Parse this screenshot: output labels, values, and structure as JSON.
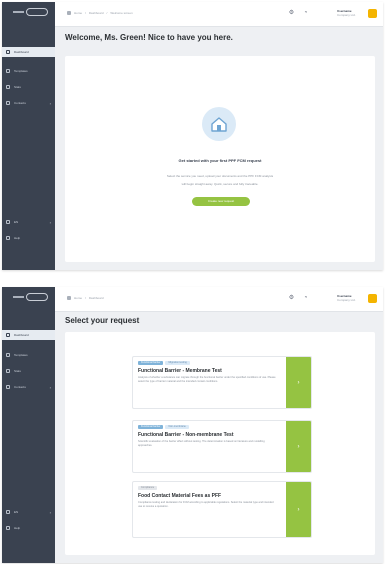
{
  "screen1": {
    "sidebar": {
      "items": [
        {
          "label": "Dashboard",
          "icon": "grid-icon"
        },
        {
          "label": "Templates",
          "icon": "document-icon"
        },
        {
          "label": "Stats",
          "icon": "chart-icon"
        },
        {
          "label": "Contacts",
          "icon": "people-icon"
        }
      ],
      "bottom_items": [
        {
          "label": "EN",
          "icon": "globe-icon"
        },
        {
          "label": "Help",
          "icon": "help-icon"
        }
      ]
    },
    "topbar": {
      "breadcrumb": [
        "Home",
        "Dashboard",
        "Welcome screen"
      ],
      "user_name": "Username",
      "user_company": "Company Ltd."
    },
    "page_title": "Welcome, Ms. Green! Nice to have you here.",
    "empty_state": {
      "title": "Get started with your first PPF FCM request",
      "text_line1": "Select the service you need, upload your documents and the PPF FCM analysis",
      "text_line2": "will begin straight away. Quick, secure and fully traceable.",
      "button": "Create new request"
    }
  },
  "screen2": {
    "page_title": "Select your request",
    "cards": [
      {
        "badges": [
          "Functional barrier",
          "Migration testing"
        ],
        "title": "Functional Barrier - Membrane Test",
        "desc": "Analysis of whether a substance can migrate through the functional barrier under the specified conditions of use. Please select the type of barrier material and the intended contact conditions."
      },
      {
        "badges": [
          "Functional barrier",
          "Non-membrane"
        ],
        "title": "Functional Barrier - Non-membrane Test",
        "desc": "Scientific evaluation of the barrier effect without testing. The determination is based on literature and modelling approaches."
      },
      {
        "badges": [
          "Compliance"
        ],
        "title": "Food Contact Material Fees as PFF",
        "desc": "Compliance testing and declaration for FCM according to applicable regulations. Select the material type and intended use to receive a quotation."
      }
    ]
  }
}
